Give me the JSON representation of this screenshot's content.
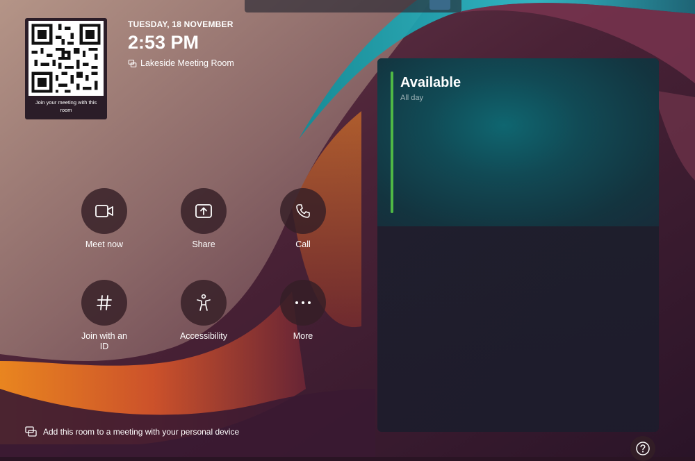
{
  "header": {
    "date": "TUESDAY, 18 NOVEMBER",
    "time": "2:53 PM",
    "room_name": "Lakeside Meeting Room"
  },
  "qr": {
    "caption": "Join your meeting with this room"
  },
  "actions": [
    {
      "label": "Meet now",
      "icon": "video-camera-icon"
    },
    {
      "label": "Share",
      "icon": "share-screen-icon"
    },
    {
      "label": "Call",
      "icon": "phone-icon"
    },
    {
      "label": "Join with an ID",
      "icon": "hash-icon"
    },
    {
      "label": "Accessibility",
      "icon": "accessibility-icon"
    },
    {
      "label": "More",
      "icon": "more-dots-icon"
    }
  ],
  "schedule": {
    "status": "Available",
    "duration": "All day",
    "status_color": "#4fb845"
  },
  "footer": {
    "note": "Add this room to a meeting with your personal device"
  },
  "help": {
    "icon": "help-icon"
  }
}
